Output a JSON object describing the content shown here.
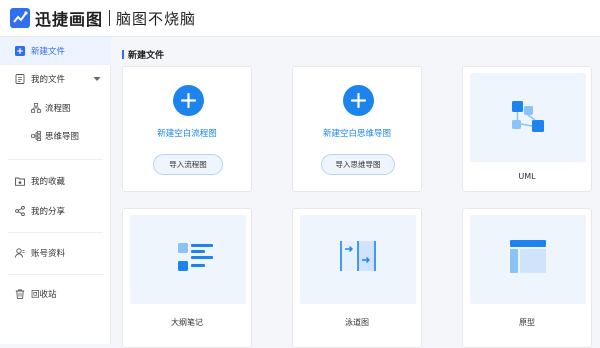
{
  "header": {
    "brand_name": "迅捷画图",
    "slogan": "脑图不烧脑"
  },
  "sidebar": {
    "items": [
      {
        "label": "新建文件",
        "icon": "plus-square-icon",
        "active": true
      },
      {
        "label": "我的文件",
        "icon": "document-icon",
        "expanded": true
      },
      {
        "label": "流程图",
        "icon": "flowchart-icon"
      },
      {
        "label": "思维导图",
        "icon": "mindmap-icon"
      },
      {
        "label": "我的收藏",
        "icon": "star-folder-icon"
      },
      {
        "label": "我的分享",
        "icon": "share-icon"
      },
      {
        "label": "账号资料",
        "icon": "user-icon"
      },
      {
        "label": "回收站",
        "icon": "trash-icon"
      }
    ]
  },
  "main": {
    "section_title": "新建文件",
    "cards": [
      {
        "link": "新建空白流程图",
        "button": "导入流程图"
      },
      {
        "link": "新建空白思维导图",
        "button": "导入思维导图"
      },
      {
        "label": "UML",
        "icon": "uml-icon"
      },
      {
        "label": "大纲笔记",
        "icon": "outline-icon"
      },
      {
        "label": "泳道图",
        "icon": "swimlane-icon"
      },
      {
        "label": "原型",
        "icon": "prototype-icon"
      }
    ]
  },
  "colors": {
    "accent": "#1d84ee",
    "brand": "#2f6ff0",
    "thumb_bg": "#eef5fd",
    "icon_dark": "#1d84ee",
    "icon_light": "#8cc3f7"
  }
}
